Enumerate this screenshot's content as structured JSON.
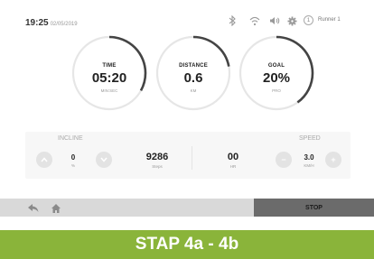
{
  "status_bar": {
    "time": "19:25",
    "date": "02/05/2019",
    "icons": [
      "bluetooth-icon",
      "wifi-icon",
      "volume-icon",
      "settings-gear-icon"
    ],
    "user_initial": "1",
    "user_name": "Runner 1"
  },
  "gauges": [
    {
      "title": "TIME",
      "value": "05:20",
      "unit": "MIN:SEC",
      "progress": 0.33
    },
    {
      "title": "DISTANCE",
      "value": "0.6",
      "unit": "KM",
      "progress": 0.22
    },
    {
      "title": "GOAL",
      "value": "20%",
      "unit": "PRO",
      "progress": 0.4
    }
  ],
  "incline": {
    "label": "INCLINE",
    "value": "0",
    "unit": "%"
  },
  "steps": {
    "value": "9286",
    "unit": "Steps"
  },
  "heart_rate": {
    "value": "00",
    "unit": "HR"
  },
  "speed": {
    "label": "SPEED",
    "value": "3.0",
    "unit": "KM/H",
    "minus": "−",
    "plus": "+"
  },
  "toolbar": {
    "stop_label": "STOP"
  },
  "banner": {
    "text": "STAP 4a - 4b"
  },
  "colors": {
    "accent_green": "#8ab43a",
    "stop_gray": "#6b6b6b",
    "toolbar_gray": "#d9d9d9",
    "ring": "#444444"
  }
}
